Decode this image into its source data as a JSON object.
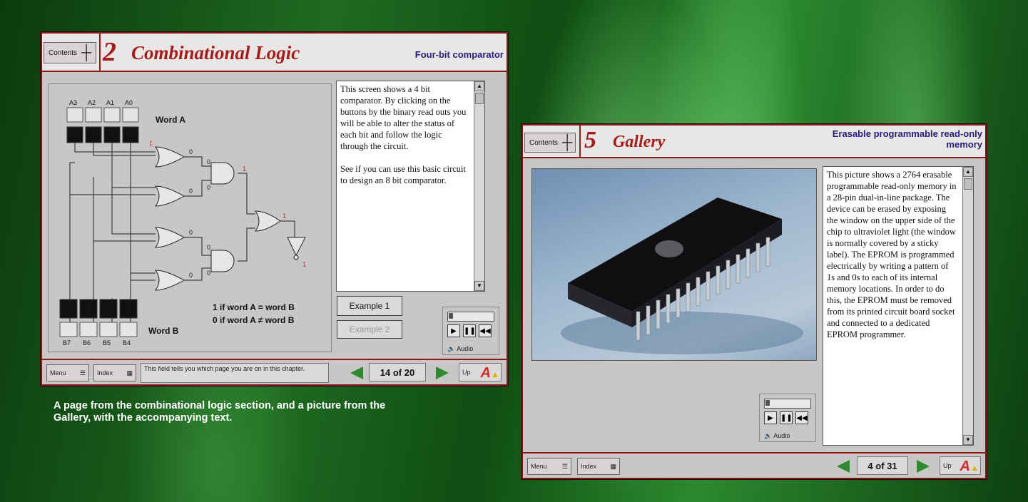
{
  "left_window": {
    "contents_label": "Contents",
    "chapter_number": "2",
    "chapter_title": "Combinational Logic",
    "subtitle": "Four-bit comparator",
    "circuit": {
      "top_bit_labels": [
        "A3",
        "A2",
        "A1",
        "A0"
      ],
      "word_a_label": "Word A",
      "bottom_bit_labels": [
        "B7",
        "B6",
        "B5",
        "B4"
      ],
      "word_b_label": "Word B",
      "equal_text": "1 if word A = word B",
      "notequal_text": "0 if word A ≠ word B",
      "gate_values": [
        "0",
        "0",
        "0",
        "0",
        "0",
        "0",
        "0",
        "0",
        "1",
        "1",
        "1",
        "1"
      ]
    },
    "text": "This screen shows a 4 bit comparator. By clicking on the buttons by the binary read outs you will be able to alter the status of each bit and follow the logic through the circuit.",
    "text2": "See if you can use this basic circuit to design an 8 bit comparator.",
    "example1": "Example 1",
    "example2": "Example 2",
    "audio_label": "Audio",
    "menu_label": "Menu",
    "index_label": "Index",
    "status_field": "This field tells you which page you are on in this chapter.",
    "page_indicator": "14 of 20",
    "up_label": "Up"
  },
  "right_window": {
    "contents_label": "Contents",
    "chapter_number": "5",
    "chapter_title": "Gallery",
    "subtitle": "Erasable programmable read-only memory",
    "text": "This picture shows a 2764 erasable programmable read-only memory in a 28-pin dual-in-line package. The device can be erased by exposing the window on the upper side of the chip to ultraviolet light (the window is normally covered by a sticky label). The EPROM is programmed electrically by writing a pattern of 1s and 0s to each of its internal memory locations. In order to do this, the EPROM must be removed from its printed circuit board socket and connected to a dedicated EPROM programmer.",
    "audio_label": "Audio",
    "menu_label": "Menu",
    "index_label": "Index",
    "page_indicator": "4 of 31",
    "up_label": "Up"
  },
  "caption": "A page from the combinational logic section, and a picture from the Gallery, with the accompanying text.",
  "colors": {
    "accent": "#a31d1d",
    "subtitle": "#2b1b7a",
    "nav_arrow": "#2f8a2f",
    "window_bg": "#c9c6c6"
  }
}
